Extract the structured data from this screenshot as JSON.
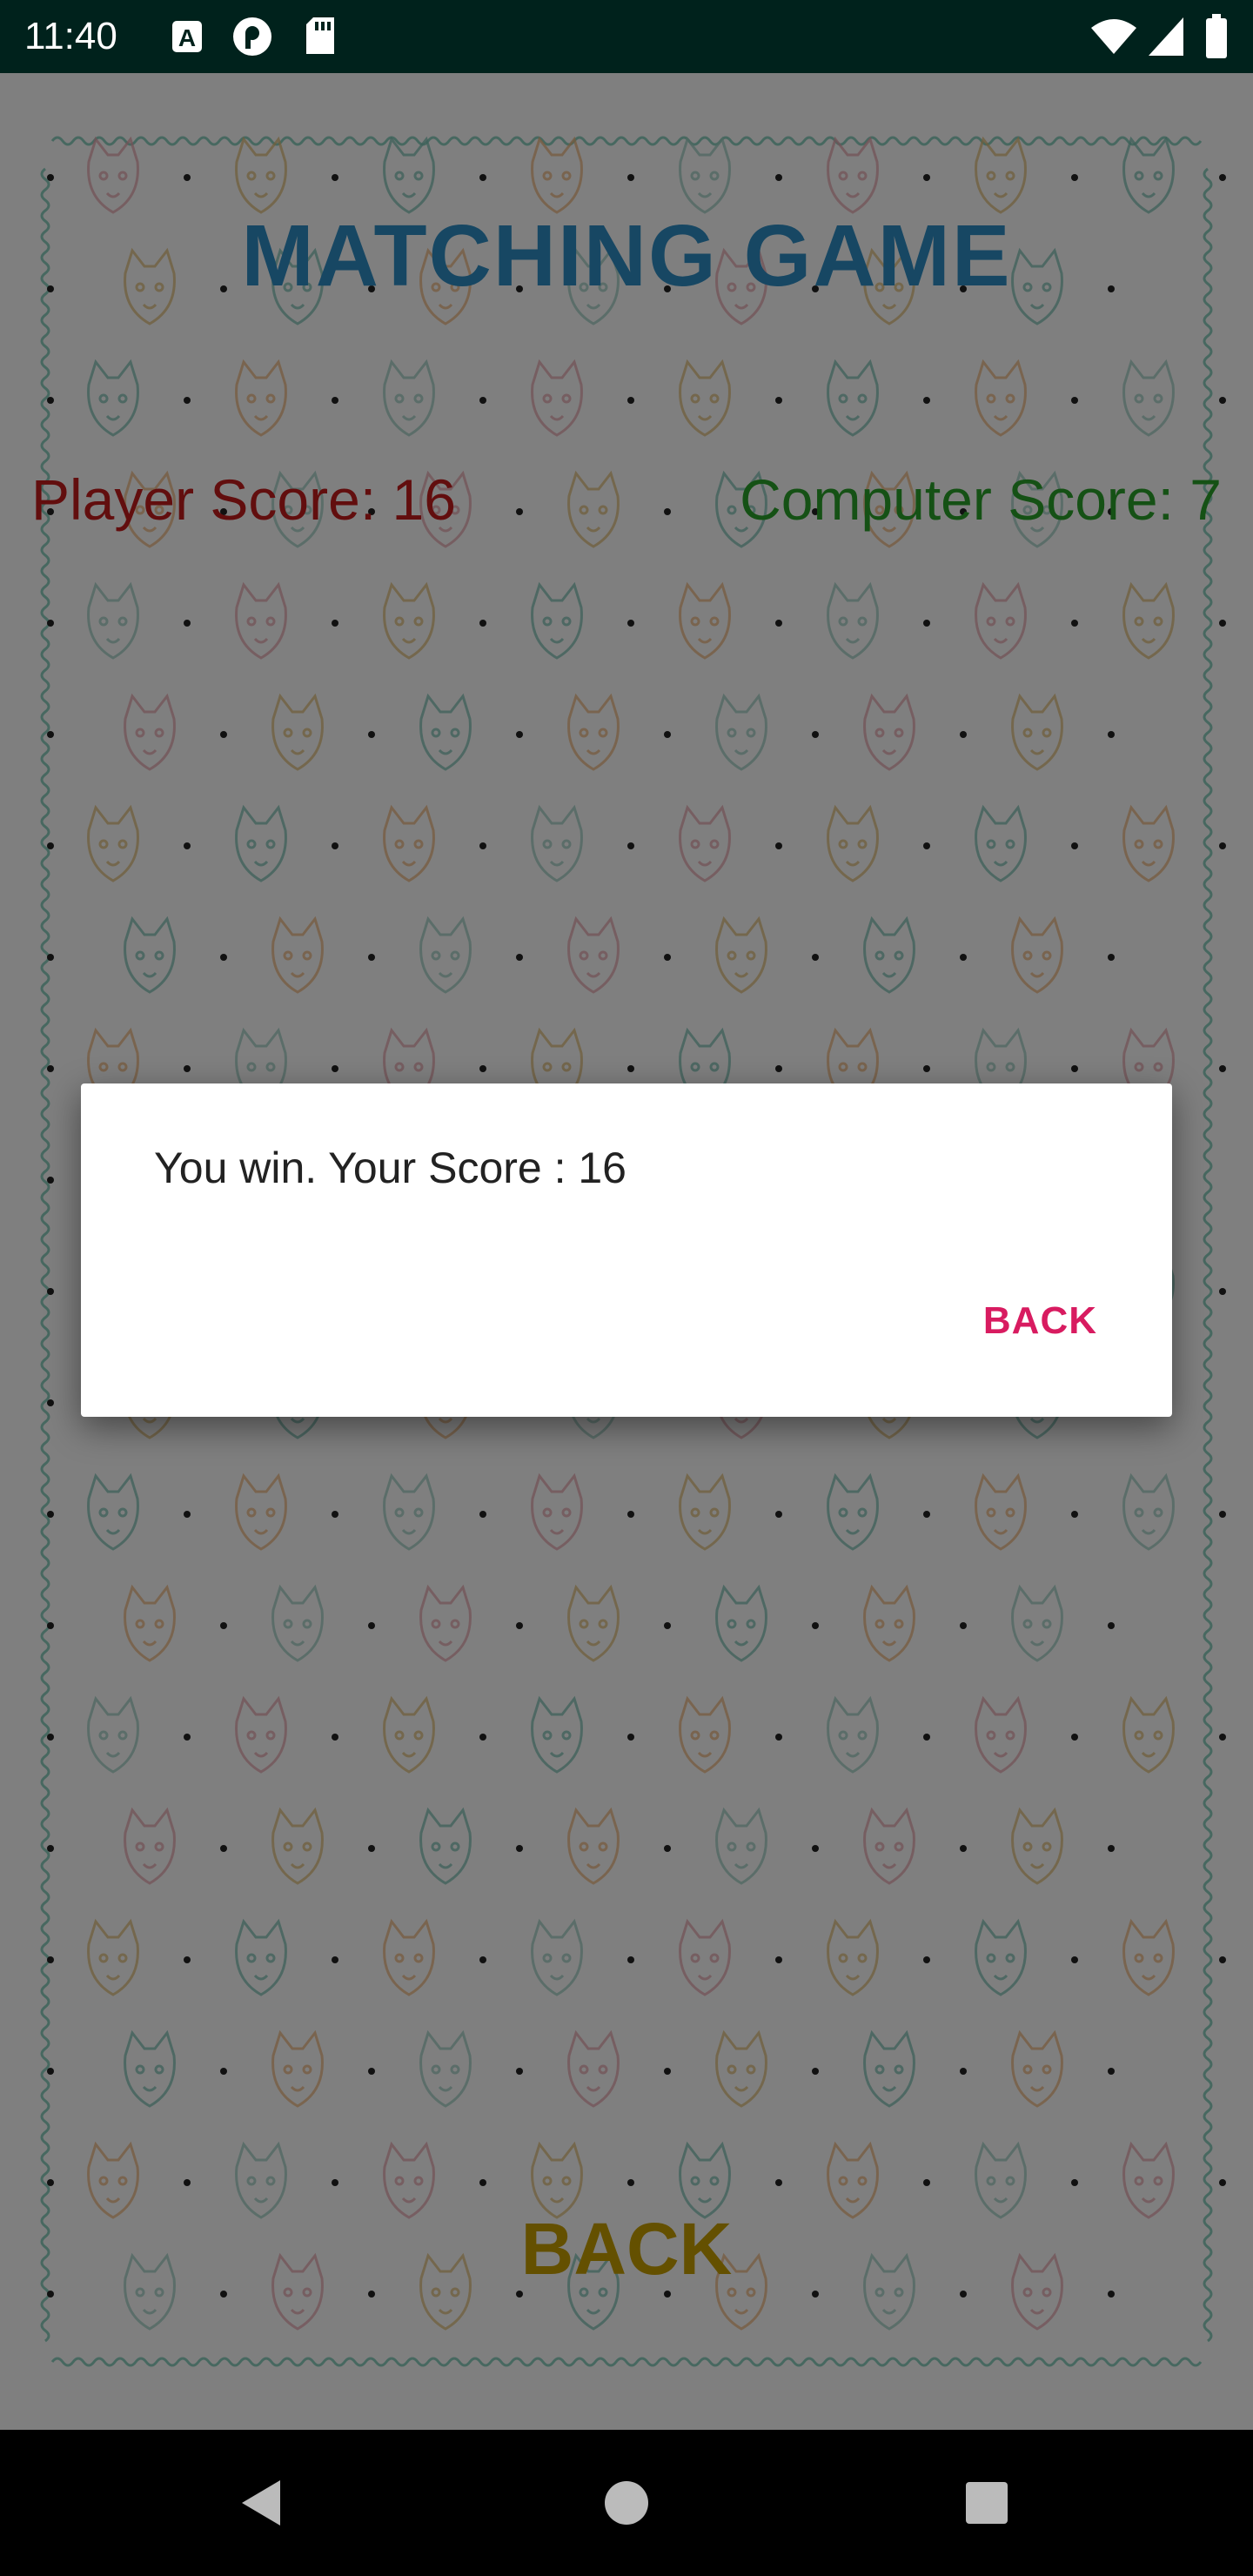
{
  "status_bar": {
    "time": "11:40",
    "icons": [
      "a-badge-icon",
      "p-circle-icon",
      "sd-card-icon",
      "wifi-icon",
      "signal-icon",
      "battery-icon"
    ]
  },
  "app": {
    "title": "MATCHING GAME",
    "player_score": "Player Score: 16",
    "computer_score": "Computer Score: 7",
    "back_label": "BACK",
    "colors": {
      "title": "#2f8fc6",
      "player": "#c41c1c",
      "computer": "#2aa32a",
      "back": "#c8a000"
    }
  },
  "dialog": {
    "message": "You win. Your Score : 16",
    "button_label": "BACK",
    "button_color": "#d81b60"
  },
  "nav_bar": {
    "buttons": [
      "back-triangle-icon",
      "home-circle-icon",
      "recents-square-icon"
    ]
  }
}
